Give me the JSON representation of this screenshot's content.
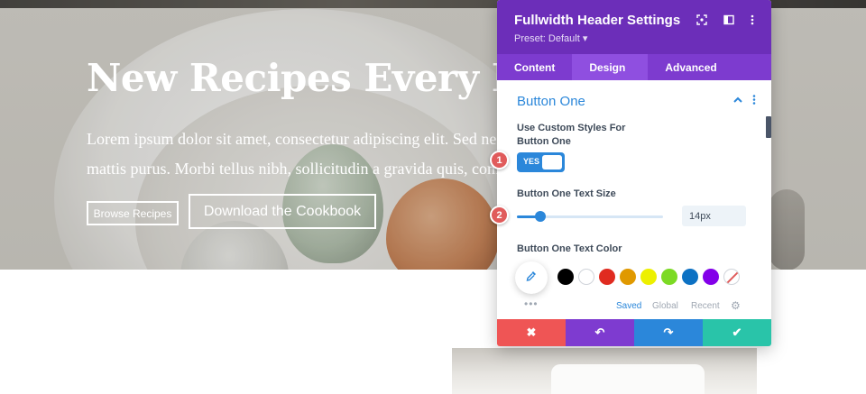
{
  "hero": {
    "title": "New Recipes Every Day",
    "body_line1": "Lorem ipsum dolor sit amet, consectetur adipiscing elit. Sed nec",
    "body_line2": "mattis purus. Morbi tellus nibh, sollicitudin a gravida quis, com",
    "button_one_label": "Browse Recipes",
    "button_two_label": "Download the Cookbook"
  },
  "panel": {
    "title": "Fullwidth Header Settings",
    "preset": "Preset: Default ▾",
    "header_icons": [
      "focus-icon",
      "layout-icon",
      "more-icon"
    ],
    "tabs": [
      {
        "label": "Content",
        "active": false
      },
      {
        "label": "Design",
        "active": true
      },
      {
        "label": "Advanced",
        "active": false
      }
    ],
    "section": {
      "title": "Button One",
      "expanded": true
    },
    "custom_styles_label_line1": "Use Custom Styles For",
    "custom_styles_label_line2": "Button One",
    "toggle_value": "YES",
    "text_size_label": "Button One Text Size",
    "text_size_value": "14px",
    "text_size_slider_fraction": 0.16,
    "text_color_label": "Button One Text Color",
    "palette_colors": [
      "#000000",
      "#ffffff",
      "#e02b20",
      "#e09900",
      "#edf000",
      "#7cda24",
      "#0c71c3",
      "#8300e9"
    ],
    "palette_tabs": [
      {
        "label": "Saved",
        "active": true
      },
      {
        "label": "Global",
        "active": false
      },
      {
        "label": "Recent",
        "active": false
      }
    ],
    "footer_buttons": [
      {
        "name": "cancel",
        "symbol": "✖",
        "color": "#ef5555"
      },
      {
        "name": "undo",
        "symbol": "↶",
        "color": "#7e3bd0"
      },
      {
        "name": "redo",
        "symbol": "↷",
        "color": "#2b87da"
      },
      {
        "name": "save",
        "symbol": "✔",
        "color": "#29c4a9"
      }
    ]
  },
  "annotations": [
    {
      "number": "1"
    },
    {
      "number": "2"
    }
  ],
  "colors": {
    "panel_header": "#6c2eb9",
    "tabs_bar": "#7d3bcf",
    "accent_blue": "#2b87da",
    "badge_red": "#e05b5b"
  }
}
